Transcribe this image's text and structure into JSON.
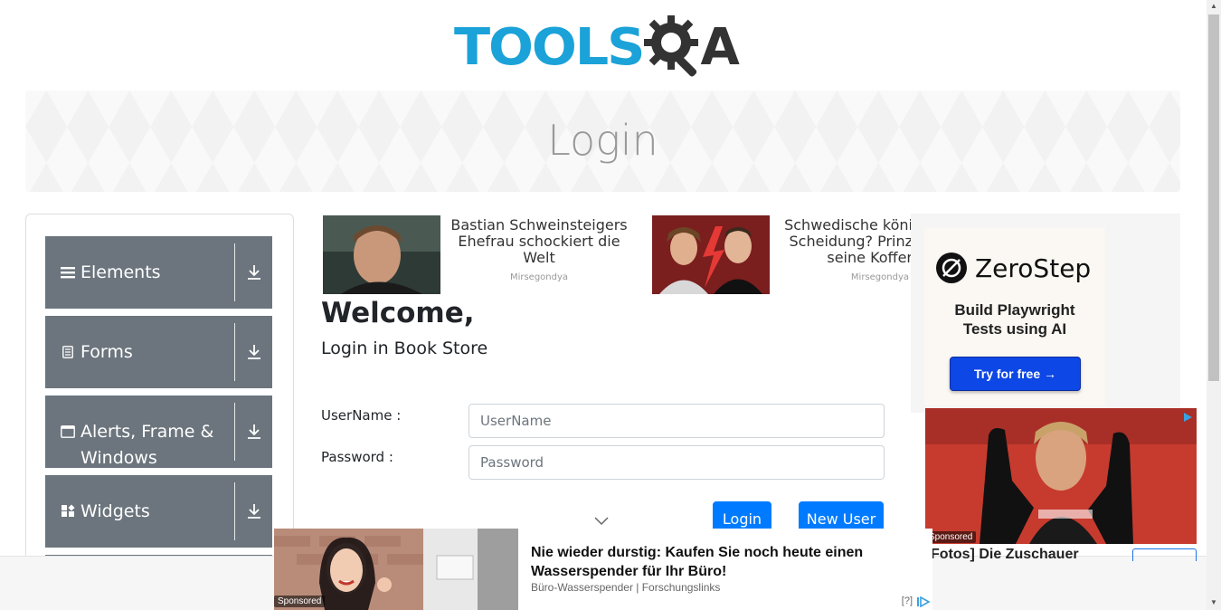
{
  "header": {
    "logo_text_left": "TOOLS",
    "logo_text_right": "A"
  },
  "banner": {
    "title": "Login"
  },
  "sidebar": {
    "groups": [
      {
        "label": "Elements",
        "icon": "hamburger-icon"
      },
      {
        "label": "Forms",
        "icon": "document-icon"
      },
      {
        "label_line1": "Alerts, Frame &",
        "label_line2": "Windows",
        "icon": "window-icon"
      },
      {
        "label": "Widgets",
        "icon": "widgets-icon"
      }
    ]
  },
  "top_ads": [
    {
      "line1": "Bastian Schweinsteigers",
      "line2": "Ehefrau schockiert die Welt",
      "source": "Mirsegondya"
    },
    {
      "line1": "Schwedische köni",
      "line2": "Scheidung? Prinz",
      "line3": "seine Koffer",
      "source": "Mirsegondya"
    }
  ],
  "login": {
    "welcome": "Welcome,",
    "subtitle": "Login in Book Store",
    "username_label": "UserName :",
    "username_placeholder": "UserName",
    "password_label": "Password :",
    "password_placeholder": "Password",
    "login_button": "Login",
    "new_user_button": "New User"
  },
  "right_ad": {
    "brand": "ZeroStep",
    "tagline_line1": "Build Playwright",
    "tagline_line2": "Tests using AI",
    "cta": "Try for free →",
    "sponsored": "Sponsored",
    "caption": "Fotos] Die Zuschauer"
  },
  "bottom_ad": {
    "title": "Nie wieder durstig: Kaufen Sie noch heute einen Wasserspender für Ihr Büro!",
    "source": "Büro-Wasserspender | Forschungslinks",
    "sponsored": "Sponsored",
    "help": "[?]"
  },
  "colors": {
    "logo_blue": "#1ba2d8",
    "sidebar_gray": "#6c757d",
    "primary_button": "#007bff",
    "cta_blue": "#0d47e5"
  }
}
